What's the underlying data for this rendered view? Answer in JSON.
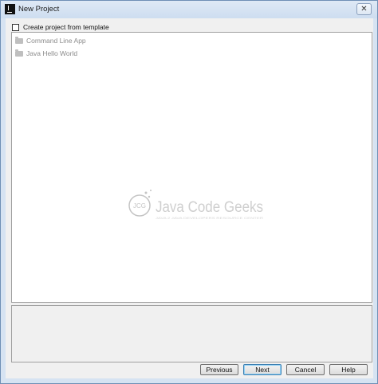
{
  "window": {
    "title": "New Project",
    "app_icon": "intellij-idea-icon",
    "close_glyph": "✕"
  },
  "template": {
    "label": "Create project from template",
    "checked": false
  },
  "templates": [
    {
      "label": "Command Line App",
      "icon": "folder-icon"
    },
    {
      "label": "Java Hello World",
      "icon": "folder-icon"
    }
  ],
  "watermark": {
    "logo_text": "JCG",
    "brand": "Java Code Geeks",
    "tagline": "JAVA 2 JAVA DEVELOPERS RESOURCE CENTER"
  },
  "buttons": {
    "previous": "Previous",
    "next": "Next",
    "cancel": "Cancel",
    "help": "Help"
  },
  "colors": {
    "titlebar": "#d6e3f2",
    "accent": "#3c7fb1",
    "disabled_text": "#8c8c8c"
  }
}
